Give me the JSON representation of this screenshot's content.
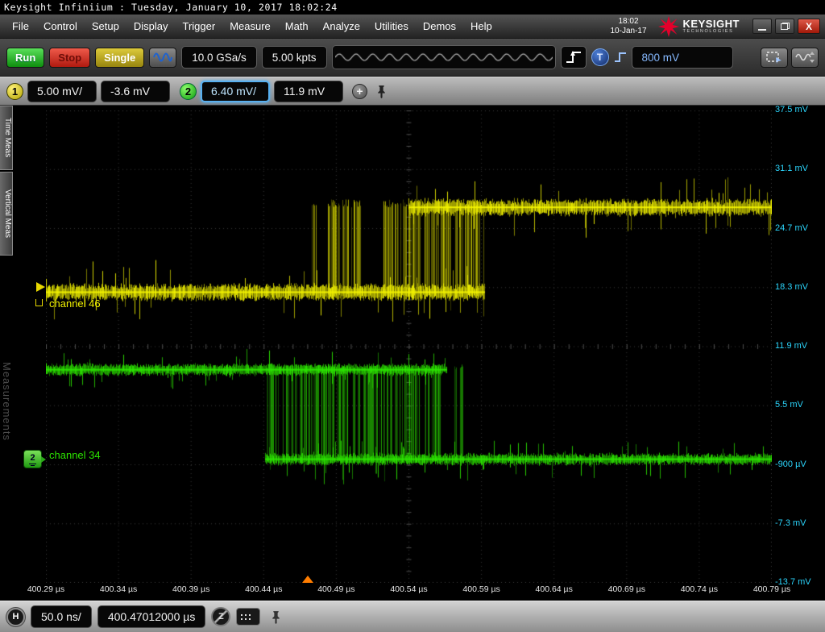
{
  "window": {
    "title": "Keysight Infiniium : Tuesday, January 10, 2017 18:02:24"
  },
  "menu": {
    "items": [
      "File",
      "Control",
      "Setup",
      "Display",
      "Trigger",
      "Measure",
      "Math",
      "Analyze",
      "Utilities",
      "Demos",
      "Help"
    ],
    "clock_time": "18:02",
    "clock_date": "10-Jan-17",
    "brand_name": "KEYSIGHT",
    "brand_sub": "TECHNOLOGIES"
  },
  "toolbar": {
    "run_label": "Run",
    "stop_label": "Stop",
    "single_label": "Single",
    "sample_rate": "10.0 GSa/s",
    "memory_depth": "5.00 kpts",
    "trigger_badge": "T",
    "trigger_level": "800 mV"
  },
  "channel_bar": {
    "channels": [
      {
        "badge": "1",
        "scale": "5.00 mV/",
        "offset": "-3.6 mV",
        "color": "#e8d800",
        "selected": false
      },
      {
        "badge": "2",
        "scale": "6.40 mV/",
        "offset": "11.9 mV",
        "color": "#35d800",
        "selected": true
      }
    ],
    "add_label": "+"
  },
  "sidebar": {
    "tabs": [
      "Time Meas",
      "Vertical Meas"
    ],
    "watermark": "Measurements"
  },
  "plot": {
    "y_labels": [
      "37.5 mV",
      "31.1 mV",
      "24.7 mV",
      "18.3 mV",
      "11.9 mV",
      "5.5 mV",
      "-900 µV",
      "-7.3 mV",
      "-13.7 mV"
    ],
    "x_labels": [
      "400.29 µs",
      "400.34 µs",
      "400.39 µs",
      "400.44 µs",
      "400.49 µs",
      "400.54 µs",
      "400.59 µs",
      "400.64 µs",
      "400.69 µs",
      "400.74 µs",
      "400.79 µs"
    ],
    "trace_labels": [
      "channel 46",
      "channel 34"
    ]
  },
  "bottom_bar": {
    "h_badge": "H",
    "timebase": "50.0 ns/",
    "horizontal_position": "400.47012000 µs",
    "zoom_badge": "Z"
  },
  "chart_data": {
    "type": "line",
    "title": "Oscilloscope capture: two digital serial lines with burst transition region",
    "x_unit": "µs",
    "y_unit": "mV",
    "x_range": [
      400.29,
      400.79
    ],
    "y_range": [
      -13.7,
      37.5
    ],
    "x_divisions": 10,
    "y_divisions": 8,
    "x_tick_step_us": 0.05,
    "y_tick_step_mv": 6.4,
    "timebase": "50.0 ns/div",
    "grid": true,
    "series": [
      {
        "name": "channel 46",
        "scope_channel": 1,
        "color": "#f2f200",
        "low_mv": 17.8,
        "high_mv": 27.0,
        "noise_mv": 0.85,
        "bands": [
          {
            "level_mv": 17.8,
            "from_us": 400.29,
            "to_us": 400.592
          },
          {
            "level_mv": 27.0,
            "from_us": 400.54,
            "to_us": 400.79
          }
        ],
        "bursts": [
          [
            400.4735,
            400.4765
          ],
          [
            400.484,
            400.507
          ],
          [
            400.522,
            400.548
          ],
          [
            400.551,
            400.569
          ],
          [
            400.571,
            400.592
          ]
        ]
      },
      {
        "name": "channel 34",
        "scope_channel": 2,
        "color": "#2ce600",
        "low_mv": -0.3,
        "high_mv": 9.4,
        "noise_mv": 0.6,
        "bands": [
          {
            "level_mv": 9.4,
            "from_us": 400.29,
            "to_us": 400.566
          },
          {
            "level_mv": -0.3,
            "from_us": 400.441,
            "to_us": 400.79
          }
        ],
        "bursts": [
          [
            400.4415,
            400.4505
          ],
          [
            400.4535,
            400.498
          ],
          [
            400.5015,
            400.548
          ],
          [
            400.551,
            400.5615
          ],
          [
            400.5715,
            400.578
          ]
        ]
      }
    ],
    "trigger": {
      "position_us": 400.47012,
      "level": "800 mV",
      "marker_color": "#ff7d00"
    }
  }
}
